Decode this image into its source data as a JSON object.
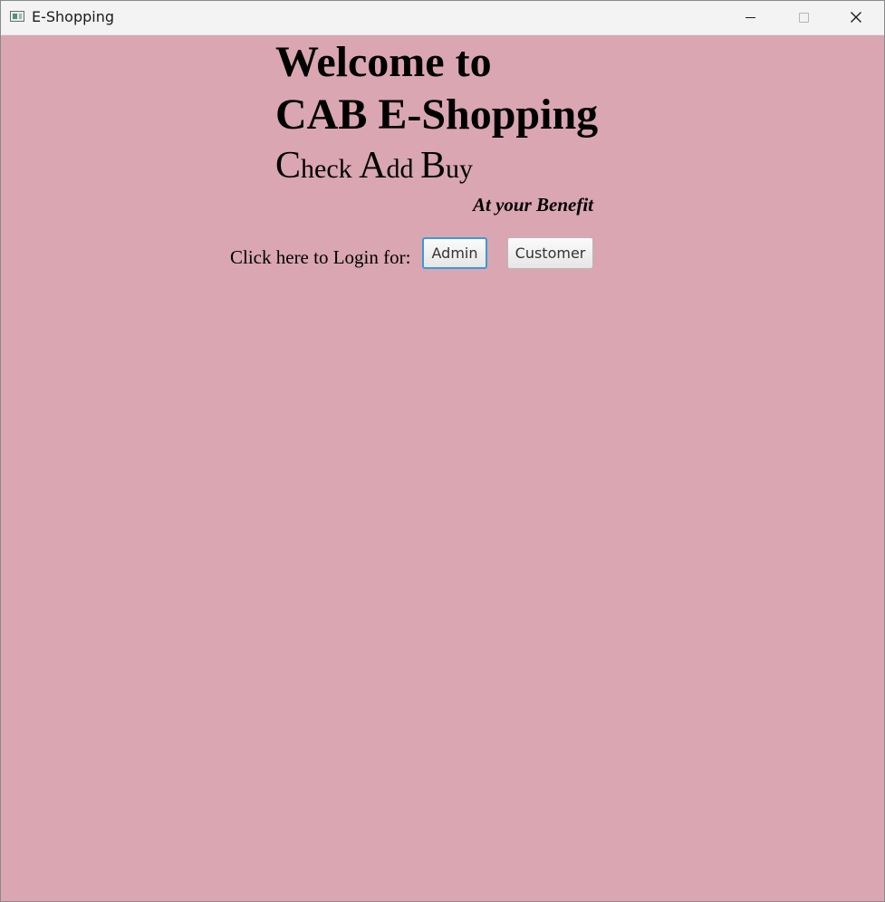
{
  "window": {
    "title": "E-Shopping",
    "icon": "app-window-icon",
    "controls": {
      "minimize": "minimize-icon",
      "maximize": "maximize-icon",
      "close": "close-icon"
    }
  },
  "colors": {
    "background": "#d9a6b2",
    "focus_ring": "#3a9ad9"
  },
  "welcome": {
    "line1": "Welcome to",
    "line2": "CAB E-Shopping",
    "tagline": {
      "c": "C",
      "heck": "heck ",
      "a": "A",
      "dd": "dd ",
      "b": "B",
      "uy": "uy"
    },
    "benefit": "At your Benefit"
  },
  "login": {
    "label": "Click here to Login for:",
    "admin_button": "Admin",
    "customer_button": "Customer"
  }
}
